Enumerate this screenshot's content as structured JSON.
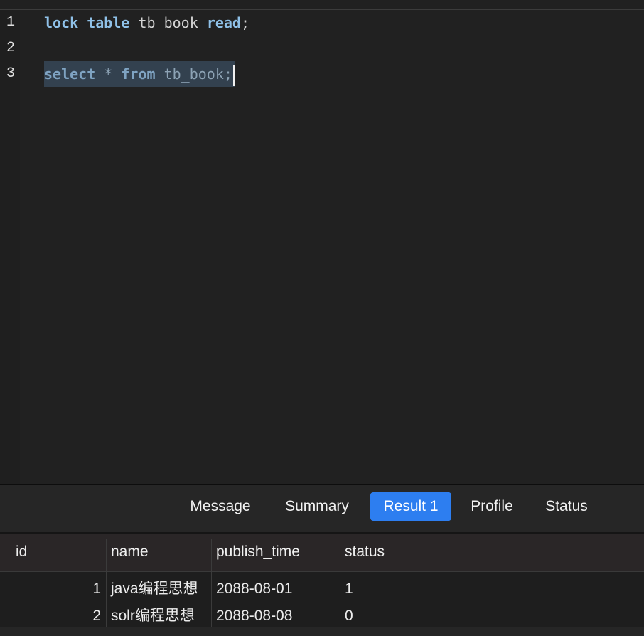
{
  "editor": {
    "line_numbers": [
      "1",
      "2",
      "3"
    ],
    "lines": [
      [
        {
          "t": "lock",
          "k": "kw"
        },
        {
          "t": " ",
          "k": "id"
        },
        {
          "t": "table",
          "k": "kw"
        },
        {
          "t": " tb_book ",
          "k": "id"
        },
        {
          "t": "read",
          "k": "kw"
        },
        {
          "t": ";",
          "k": "id"
        }
      ],
      [],
      [
        {
          "t": "select",
          "k": "kw"
        },
        {
          "t": " * ",
          "k": "op"
        },
        {
          "t": "from",
          "k": "kw"
        },
        {
          "t": " tb_book;",
          "k": "id"
        }
      ]
    ]
  },
  "tabs": [
    {
      "label": "Message",
      "active": false
    },
    {
      "label": "Summary",
      "active": false
    },
    {
      "label": "Result 1",
      "active": true
    },
    {
      "label": "Profile",
      "active": false
    },
    {
      "label": "Status",
      "active": false
    }
  ],
  "result": {
    "columns": [
      "id",
      "name",
      "publish_time",
      "status"
    ],
    "rows": [
      [
        "1",
        "java编程思想",
        "2088-08-01",
        "1"
      ],
      [
        "2",
        "solr编程思想",
        "2088-08-08",
        "0"
      ]
    ]
  },
  "colors": {
    "keyword": "#8fc1e8",
    "selection": "#33414f",
    "active_tab": "#2d7ef0"
  }
}
